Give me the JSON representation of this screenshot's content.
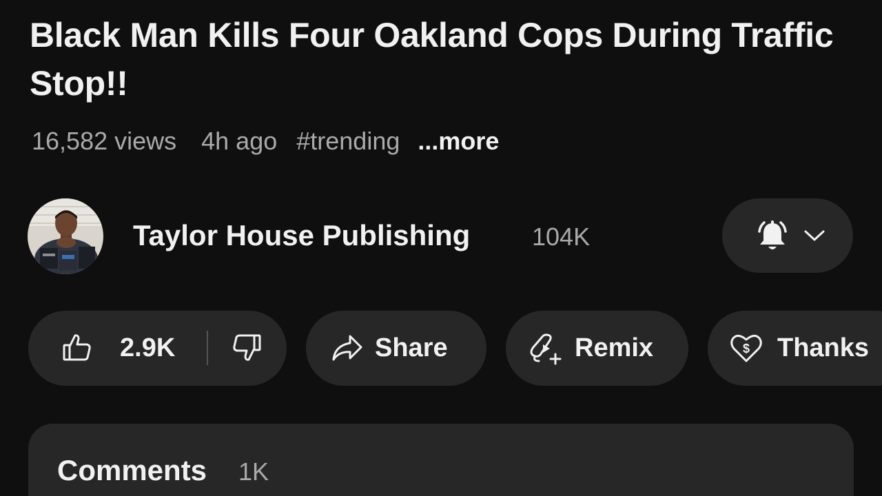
{
  "video": {
    "title": "Black Man Kills Four Oakland Cops During Traffic Stop!!",
    "views": "16,582 views",
    "age": "4h ago",
    "hashtag": "#trending",
    "more_label": "...more"
  },
  "channel": {
    "name": "Taylor House Publishing",
    "subscribers": "104K",
    "avatar_icon": "channel-avatar",
    "notify_icon": "bell-filled-icon",
    "dropdown_icon": "chevron-down-icon"
  },
  "actions": {
    "like_count": "2.9K",
    "like_icon": "thumbs-up-icon",
    "dislike_icon": "thumbs-down-icon",
    "share_label": "Share",
    "share_icon": "share-arrow-icon",
    "remix_label": "Remix",
    "remix_icon": "remix-icon",
    "thanks_label": "Thanks",
    "thanks_icon": "heart-dollar-icon"
  },
  "comments": {
    "title": "Comments",
    "count": "1K"
  },
  "colors": {
    "background": "#0f0f0f",
    "surface": "#272727",
    "text_primary": "#f1f1f1",
    "text_secondary": "#aaaaaa"
  }
}
